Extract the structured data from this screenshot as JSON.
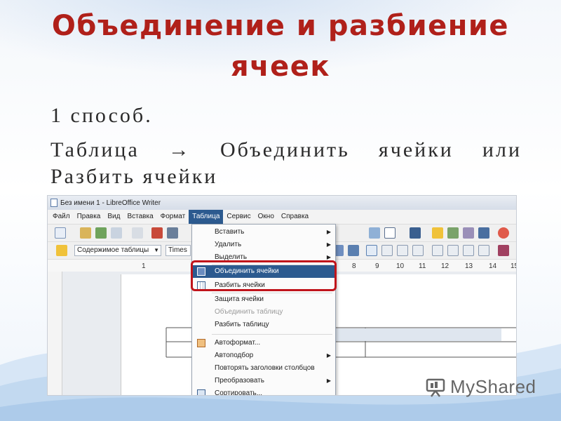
{
  "slide": {
    "title_line1": "Объединение и разбиение",
    "title_line2": "ячеек",
    "method": "1 способ.",
    "path": "Таблица → Объединить ячейки или Разбить ячейки"
  },
  "app": {
    "window_title": "Без имени 1 - LibreOffice Writer",
    "menus": [
      "Файл",
      "Правка",
      "Вид",
      "Вставка",
      "Формат",
      "Таблица",
      "Сервис",
      "Окно",
      "Справка"
    ],
    "active_menu": "Таблица",
    "paragraph_style": "Содержимое таблицы",
    "font_name": "Times",
    "ruler_numbers": [
      "1",
      "8",
      "9",
      "10",
      "11",
      "12",
      "13",
      "14",
      "15"
    ]
  },
  "dropdown": {
    "items": [
      {
        "label": "Вставить",
        "submenu": true
      },
      {
        "label": "Удалить",
        "submenu": true
      },
      {
        "label": "Выделить",
        "submenu": true
      },
      {
        "label": "Объединить ячейки",
        "highlighted": true,
        "icon": "merge-cells-icon"
      },
      {
        "label": "Разбить ячейки",
        "icon": "split-cells-icon"
      },
      {
        "label": "Защита ячейки"
      },
      {
        "label": "Объединить таблицу",
        "disabled": true
      },
      {
        "label": "Разбить таблицу"
      },
      {
        "label": "Автоформат...",
        "icon": "autoformat-icon"
      },
      {
        "label": "Автоподбор",
        "submenu": true
      },
      {
        "label": "Повторять заголовки столбцов"
      },
      {
        "label": "Преобразовать",
        "submenu": true
      },
      {
        "label": "Сортировать..."
      }
    ]
  },
  "watermark": {
    "text": "MyShared"
  },
  "colors": {
    "title": "#b0201a",
    "highlight": "#2c5a8f",
    "outline": "#c0141b"
  }
}
